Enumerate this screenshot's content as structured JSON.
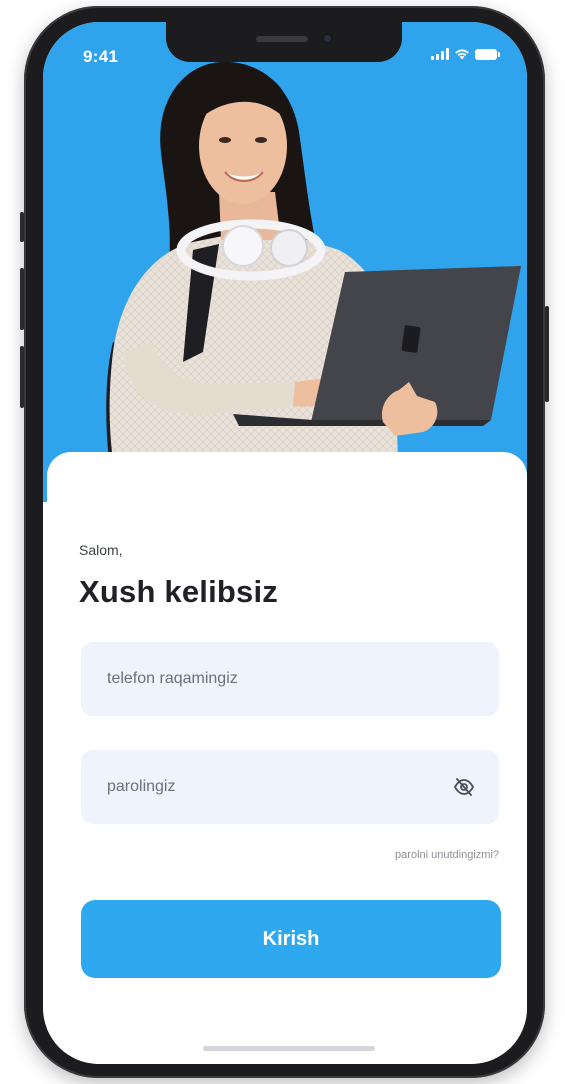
{
  "status_bar": {
    "time": "9:41",
    "icons": [
      "cellular-signal-icon",
      "wifi-icon",
      "battery-icon"
    ]
  },
  "hero": {
    "background_color": "#2fa3ec",
    "image": "student-with-laptop-photo"
  },
  "login": {
    "greeting": "Salom,",
    "title": "Xush kelibsiz",
    "phone_placeholder": "telefon raqamingiz",
    "password_placeholder": "parolingiz",
    "password_visibility_icon": "eye-off-icon",
    "forgot_link": "parolni unutdingizmi?",
    "submit_label": "Kirish"
  },
  "colors": {
    "accent": "#2ea8ee",
    "input_bg": "#eef3fc",
    "title_text": "#1f2127"
  }
}
